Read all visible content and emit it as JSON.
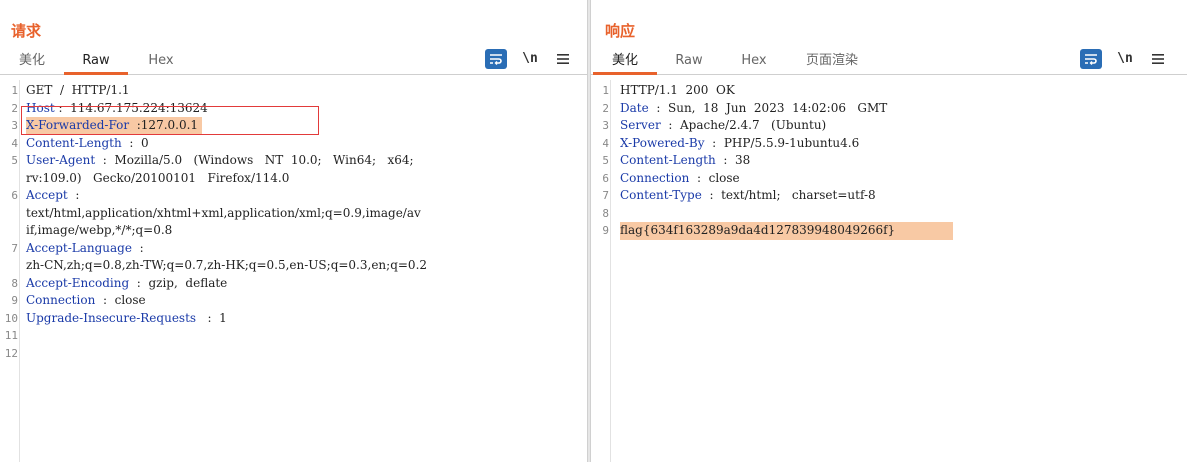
{
  "request": {
    "title": "请求",
    "tabs": [
      "美化",
      "Raw",
      "Hex"
    ],
    "active_tab": "Raw",
    "tools": {
      "newline_label": "\\n"
    },
    "lines": [
      {
        "n": "1",
        "segments": [
          {
            "t": "GET  /  HTTP/1.1",
            "k": false
          }
        ]
      },
      {
        "n": "2",
        "segments": [
          {
            "t": "Host",
            "k": true
          },
          {
            "t": " :  114.67.175.224:13624",
            "k": false
          }
        ]
      },
      {
        "n": "3",
        "segments": [
          {
            "t": "X-Forwarded-For",
            "k": true
          },
          {
            "t": "  :127.0.0.1",
            "k": false
          }
        ],
        "highlight": true
      },
      {
        "n": "4",
        "segments": [
          {
            "t": "Content-Length",
            "k": true
          },
          {
            "t": "  :  0",
            "k": false
          }
        ]
      },
      {
        "n": "5",
        "segments": [
          {
            "t": "User-Agent",
            "k": true
          },
          {
            "t": "  :  Mozilla/5.0   (Windows   NT  10.0;   Win64;   x64;",
            "k": false
          }
        ]
      },
      {
        "n": "",
        "segments": [
          {
            "t": "rv:109.0)   Gecko/20100101   Firefox/114.0",
            "k": false
          }
        ]
      },
      {
        "n": "6",
        "segments": [
          {
            "t": "Accept",
            "k": true
          },
          {
            "t": "  :",
            "k": false
          }
        ]
      },
      {
        "n": "",
        "segments": [
          {
            "t": "text/html,application/xhtml+xml,application/xml;q=0.9,image/av",
            "k": false
          }
        ]
      },
      {
        "n": "",
        "segments": [
          {
            "t": "if,image/webp,*/*;q=0.8",
            "k": false
          }
        ]
      },
      {
        "n": "7",
        "segments": [
          {
            "t": "Accept-Language",
            "k": true
          },
          {
            "t": "  :",
            "k": false
          }
        ]
      },
      {
        "n": "",
        "segments": [
          {
            "t": "zh-CN,zh;q=0.8,zh-TW;q=0.7,zh-HK;q=0.5,en-US;q=0.3,en;q=0.2",
            "k": false
          }
        ]
      },
      {
        "n": "8",
        "segments": [
          {
            "t": "Accept-Encoding",
            "k": true
          },
          {
            "t": "  :  gzip,  deflate",
            "k": false
          }
        ]
      },
      {
        "n": "9",
        "segments": [
          {
            "t": "Connection",
            "k": true
          },
          {
            "t": "  :  close",
            "k": false
          }
        ]
      },
      {
        "n": "10",
        "segments": [
          {
            "t": "Upgrade-Insecure-Requests",
            "k": true
          },
          {
            "t": "   :  1",
            "k": false
          }
        ]
      },
      {
        "n": "11",
        "segments": []
      },
      {
        "n": "12",
        "segments": []
      }
    ]
  },
  "response": {
    "title": "响应",
    "tabs": [
      "美化",
      "Raw",
      "Hex",
      "页面渲染"
    ],
    "active_tab": "美化",
    "tools": {
      "newline_label": "\\n"
    },
    "lines": [
      {
        "n": "1",
        "segments": [
          {
            "t": "HTTP/1.1  200  OK",
            "k": false
          }
        ]
      },
      {
        "n": "2",
        "segments": [
          {
            "t": "Date",
            "k": true
          },
          {
            "t": "  :  Sun,  18  Jun  2023  14:02:06   GMT",
            "k": false
          }
        ]
      },
      {
        "n": "3",
        "segments": [
          {
            "t": "Server",
            "k": true
          },
          {
            "t": "  :  Apache/2.4.7   (Ubuntu)",
            "k": false
          }
        ]
      },
      {
        "n": "4",
        "segments": [
          {
            "t": "X-Powered-By",
            "k": true
          },
          {
            "t": "  :  PHP/5.5.9-1ubuntu4.6",
            "k": false
          }
        ]
      },
      {
        "n": "5",
        "segments": [
          {
            "t": "Content-Length",
            "k": true
          },
          {
            "t": "  :  38",
            "k": false
          }
        ]
      },
      {
        "n": "6",
        "segments": [
          {
            "t": "Connection",
            "k": true
          },
          {
            "t": "  :  close",
            "k": false
          }
        ]
      },
      {
        "n": "7",
        "segments": [
          {
            "t": "Content-Type",
            "k": true
          },
          {
            "t": "  :  text/html;   charset=utf-8",
            "k": false
          }
        ]
      },
      {
        "n": "8",
        "segments": []
      },
      {
        "n": "9",
        "segments": [
          {
            "t": "flag{634f163289a9da4d127839948049266f}",
            "k": false
          }
        ],
        "highlight": true
      }
    ]
  },
  "colors": {
    "accent": "#e8622c",
    "key": "#1a3aa8",
    "highlight": "#f8c9a4",
    "tool_blue": "#2a6db5",
    "box": "#e23a3a"
  }
}
